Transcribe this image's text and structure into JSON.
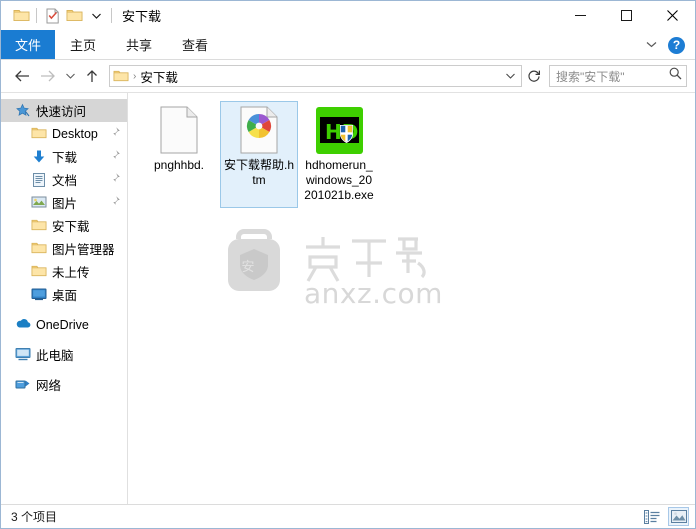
{
  "window": {
    "title": "安下载",
    "quick_access": [
      {
        "name": "folder-icon",
        "label": "属性"
      },
      {
        "name": "properties-icon",
        "label": "属性"
      },
      {
        "name": "new-folder-icon",
        "label": "新建文件夹"
      }
    ],
    "controls": {
      "minimize": "—",
      "maximize": "□",
      "close": "✕"
    }
  },
  "ribbon": {
    "tabs": [
      {
        "label": "文件",
        "active": true
      },
      {
        "label": "主页",
        "active": false
      },
      {
        "label": "共享",
        "active": false
      },
      {
        "label": "查看",
        "active": false
      }
    ],
    "collapse_label": "⌄",
    "help_label": "?"
  },
  "address": {
    "back": "←",
    "forward": "→",
    "recent": "⌄",
    "up": "↑",
    "breadcrumb": [
      "安下载"
    ],
    "dropdown": "⌄",
    "refresh": "↻"
  },
  "search": {
    "placeholder": "搜索\"安下载\"",
    "icon": "search-icon"
  },
  "sidebar": {
    "items": [
      {
        "label": "快速访问",
        "icon": "star-pin-icon",
        "selected": true,
        "indent": "root",
        "pinned": false
      },
      {
        "label": "Desktop",
        "icon": "folder-icon",
        "selected": false,
        "indent": "indent",
        "pinned": true
      },
      {
        "label": "下载",
        "icon": "download-icon",
        "selected": false,
        "indent": "indent",
        "pinned": true
      },
      {
        "label": "文档",
        "icon": "documents-icon",
        "selected": false,
        "indent": "indent",
        "pinned": true
      },
      {
        "label": "图片",
        "icon": "pictures-icon",
        "selected": false,
        "indent": "indent",
        "pinned": true
      },
      {
        "label": "安下载",
        "icon": "folder-icon",
        "selected": false,
        "indent": "indent",
        "pinned": false
      },
      {
        "label": "图片管理器",
        "icon": "folder-icon",
        "selected": false,
        "indent": "indent",
        "pinned": false
      },
      {
        "label": "未上传",
        "icon": "folder-icon",
        "selected": false,
        "indent": "indent",
        "pinned": false
      },
      {
        "label": "桌面",
        "icon": "desktop-icon",
        "selected": false,
        "indent": "indent",
        "pinned": false
      },
      {
        "label": "OneDrive",
        "icon": "onedrive-icon",
        "selected": false,
        "indent": "root",
        "pinned": false,
        "gap_before": true
      },
      {
        "label": "此电脑",
        "icon": "this-pc-icon",
        "selected": false,
        "indent": "root",
        "pinned": false,
        "gap_before": true
      },
      {
        "label": "网络",
        "icon": "network-icon",
        "selected": false,
        "indent": "root",
        "pinned": false,
        "gap_before": true
      }
    ]
  },
  "files": [
    {
      "name": "pnghhbd.",
      "icon": "blank-document-icon",
      "selected": false
    },
    {
      "name": "安下载帮助.htm",
      "icon": "chrome-html-icon",
      "selected": true
    },
    {
      "name": "hdhomerun_windows_20201021b.exe",
      "icon": "hd-homerun-app-icon",
      "selected": false
    }
  ],
  "watermark": {
    "text": "安下载",
    "domain": "anxz.com"
  },
  "status": {
    "item_count": "3 个项目",
    "views": [
      {
        "name": "details-view-button",
        "active": false
      },
      {
        "name": "large-icons-view-button",
        "active": true
      }
    ]
  },
  "colors": {
    "accent": "#1a7cd2",
    "selection_bg": "#e2f0fb",
    "selection_border": "#9bc8e8",
    "sidebar_selected": "#d6d6d6",
    "folder_yellow": "#fcd77f",
    "hd_green": "#3ecf00"
  }
}
